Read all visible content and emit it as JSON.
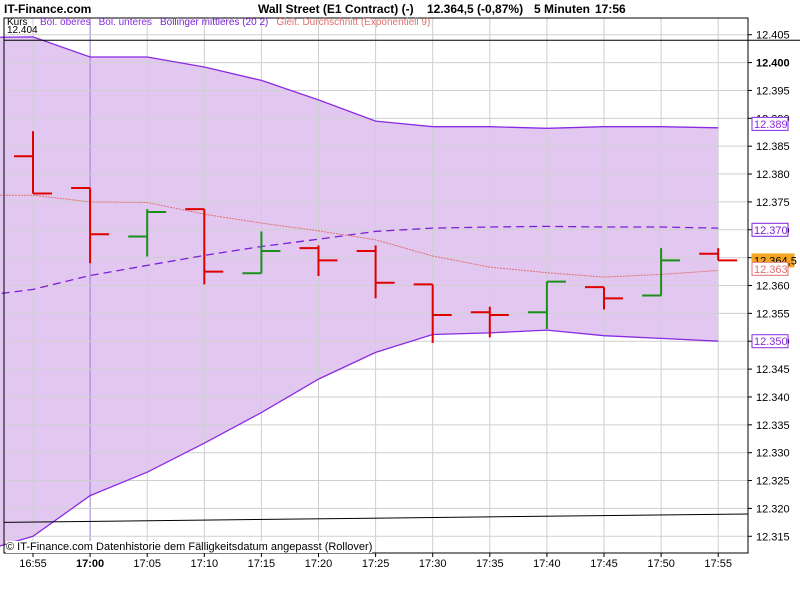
{
  "header": {
    "site": "IT-Finance.com",
    "instrument": "Wall Street (E1 Contract) (-)",
    "quote": "12.364,5 (-0,87%)",
    "interval": "5 Minuten",
    "time": "17:56"
  },
  "legend": {
    "kurs": "Kurs",
    "kurs_value": "12.404",
    "bol_upper": "Bol. oberes",
    "bol_lower": "Bol. unteres",
    "bol_middle": "Bollinger mittleres (20 2)",
    "ema": "Gleit. Durchschnitt (Exponentiell 9)"
  },
  "footer": "© IT-Finance.com Datenhistorie dem Fälligkeitsdatum angepasst (Rollover)",
  "colors": {
    "band_fill": "#e2c8f0",
    "band_line": "#8a2be2",
    "bollinger_mid": "#7a1fd6",
    "ema": "#e07070",
    "up_bar": "#1a8f1a",
    "down_bar": "#e00000",
    "grid": "#cfcfcf",
    "last_price_box": "#f5a623"
  },
  "chart_data": {
    "type": "ohlc",
    "title": "Wall Street (E1 Contract) (-)",
    "x_tick_labels": [
      "16:55",
      "17:00",
      "17:05",
      "17:10",
      "17:15",
      "17:20",
      "17:25",
      "17:30",
      "17:35",
      "17:40",
      "17:45",
      "17:50",
      "17:55"
    ],
    "y_tick_labels": [
      "12.405",
      "12.400",
      "12.395",
      "12.390",
      "12.385",
      "12.380",
      "12.375",
      "12.370",
      "12.365",
      "12.360",
      "12.355",
      "12.350",
      "12.345",
      "12.340",
      "12.335",
      "12.330",
      "12.325",
      "12.320",
      "12.315"
    ],
    "ylim": [
      12312,
      12408
    ],
    "times": [
      "16:55",
      "17:00",
      "17:05",
      "17:10",
      "17:15",
      "17:20",
      "17:25",
      "17:30",
      "17:35",
      "17:40",
      "17:45",
      "17:50",
      "17:55"
    ],
    "ohlc": [
      {
        "t": "16:55",
        "o": 12383.2,
        "h": 12387.7,
        "l": 12376.5,
        "c": 12376.5
      },
      {
        "t": "17:00",
        "o": 12377.5,
        "h": 12377.5,
        "l": 12364.0,
        "c": 12369.2
      },
      {
        "t": "17:05",
        "o": 12368.8,
        "h": 12373.7,
        "l": 12365.2,
        "c": 12373.2
      },
      {
        "t": "17:10",
        "o": 12373.7,
        "h": 12373.7,
        "l": 12360.2,
        "c": 12362.5
      },
      {
        "t": "17:15",
        "o": 12362.2,
        "h": 12369.7,
        "l": 12362.2,
        "c": 12366.2
      },
      {
        "t": "17:20",
        "o": 12366.7,
        "h": 12367.2,
        "l": 12361.7,
        "c": 12364.5
      },
      {
        "t": "17:25",
        "o": 12366.2,
        "h": 12367.2,
        "l": 12357.7,
        "c": 12360.5
      },
      {
        "t": "17:30",
        "o": 12360.2,
        "h": 12360.2,
        "l": 12349.7,
        "c": 12354.7
      },
      {
        "t": "17:35",
        "o": 12355.2,
        "h": 12356.2,
        "l": 12350.7,
        "c": 12354.7
      },
      {
        "t": "17:40",
        "o": 12355.2,
        "h": 12360.7,
        "l": 12352.2,
        "c": 12360.7
      },
      {
        "t": "17:45",
        "o": 12359.7,
        "h": 12359.7,
        "l": 12355.7,
        "c": 12357.7
      },
      {
        "t": "17:50",
        "o": 12358.2,
        "h": 12366.7,
        "l": 12358.2,
        "c": 12364.5
      },
      {
        "t": "17:55",
        "o": 12365.7,
        "h": 12366.7,
        "l": 12364.5,
        "c": 12364.5
      }
    ],
    "series": [
      {
        "name": "Bol. oberes",
        "x": [
          "16:50",
          "16:55",
          "17:00",
          "17:05",
          "17:10",
          "17:15",
          "17:20",
          "17:25",
          "17:30",
          "17:35",
          "17:40",
          "17:45",
          "17:50",
          "17:55"
        ],
        "values": [
          12404.5,
          12404.6,
          12401.0,
          12401.0,
          12399.2,
          12396.8,
          12393.3,
          12389.5,
          12388.5,
          12388.5,
          12388.2,
          12388.5,
          12388.5,
          12388.3
        ]
      },
      {
        "name": "Bol. unteres",
        "x": [
          "16:50",
          "16:55",
          "17:00",
          "17:05",
          "17:10",
          "17:15",
          "17:20",
          "17:25",
          "17:30",
          "17:35",
          "17:40",
          "17:45",
          "17:50",
          "17:55"
        ],
        "values": [
          12312.0,
          12315.0,
          12322.3,
          12326.5,
          12331.7,
          12337.2,
          12343.2,
          12348.0,
          12351.2,
          12351.5,
          12352.0,
          12351.0,
          12350.5,
          12350.0
        ]
      },
      {
        "name": "Bollinger mittleres (20 2)",
        "x": [
          "16:50",
          "16:55",
          "17:00",
          "17:05",
          "17:10",
          "17:15",
          "17:20",
          "17:25",
          "17:30",
          "17:35",
          "17:40",
          "17:45",
          "17:50",
          "17:55"
        ],
        "values": [
          12358.0,
          12359.3,
          12361.8,
          12363.6,
          12365.4,
          12367.0,
          12368.3,
          12369.7,
          12370.3,
          12370.5,
          12370.6,
          12370.5,
          12370.5,
          12370.3
        ]
      },
      {
        "name": "Gleit. Durchschnitt (Exponentiell 9)",
        "x": [
          "16:50",
          "16:55",
          "17:00",
          "17:05",
          "17:10",
          "17:15",
          "17:20",
          "17:25",
          "17:30",
          "17:35",
          "17:40",
          "17:45",
          "17:50",
          "17:55"
        ],
        "values": [
          12376.2,
          12376.2,
          12375.0,
          12374.9,
          12372.8,
          12371.2,
          12369.8,
          12368.2,
          12365.3,
          12363.3,
          12362.3,
          12361.5,
          12362.0,
          12362.7
        ]
      }
    ],
    "horizontal_lines": [
      {
        "name": "Kurs",
        "value": 12404.0
      },
      {
        "name": "lower-reference",
        "value_start": 12317.5,
        "value_end": 12319.0
      }
    ],
    "price_markers": [
      {
        "label": "12.389",
        "value": 12389.0,
        "color": "#8a2be2"
      },
      {
        "label": "12.370",
        "value": 12370.0,
        "color": "#7a1fd6"
      },
      {
        "label": "12.364,5",
        "value": 12364.5,
        "color": "#f5a623"
      },
      {
        "label": "12.363",
        "value": 12363.0,
        "color": "#e07070"
      },
      {
        "label": "12.350",
        "value": 12350.0,
        "color": "#8a2be2"
      }
    ],
    "grid": true,
    "legend_placement": "top-left"
  }
}
